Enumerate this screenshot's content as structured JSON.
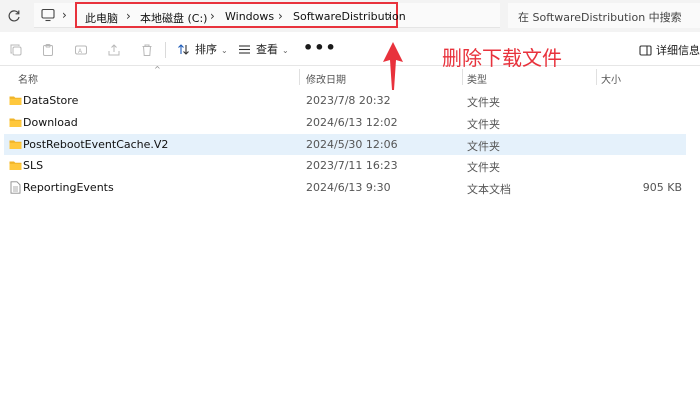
{
  "address_bar": {
    "breadcrumbs": [
      "此电脑",
      "本地磁盘 (C:)",
      "Windows",
      "SoftwareDistribution"
    ],
    "search_placeholder": "在 SoftwareDistribution 中搜索"
  },
  "toolbar": {
    "sort_label": "排序",
    "view_label": "查看",
    "more_label": "•••",
    "details_label": "详细信息"
  },
  "annotation": {
    "text": "删除下载文件",
    "color": "#e8323c"
  },
  "columns": {
    "name": "名称",
    "date": "修改日期",
    "type": "类型",
    "size": "大小"
  },
  "files": [
    {
      "name": "DataStore",
      "date": "2023/7/8 20:32",
      "type": "文件夹",
      "size": "",
      "icon": "folder-icon"
    },
    {
      "name": "Download",
      "date": "2024/6/13 12:02",
      "type": "文件夹",
      "size": "",
      "icon": "folder-icon"
    },
    {
      "name": "PostRebootEventCache.V2",
      "date": "2024/5/30 12:06",
      "type": "文件夹",
      "size": "",
      "icon": "folder-icon",
      "selected": true
    },
    {
      "name": "SLS",
      "date": "2023/7/11 16:23",
      "type": "文件夹",
      "size": "",
      "icon": "folder-icon"
    },
    {
      "name": "ReportingEvents",
      "date": "2024/6/13 9:30",
      "type": "文本文档",
      "size": "905 KB",
      "icon": "text-file-icon"
    }
  ]
}
